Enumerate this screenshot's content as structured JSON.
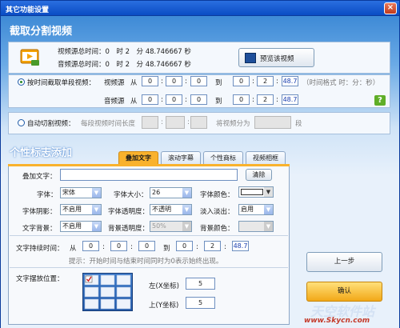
{
  "window": {
    "title": "其它功能设置",
    "close": "×"
  },
  "section1": {
    "title": "截取分割视频",
    "video_total_label": "视频源总时间：0　时 2　分 48.746667 秒",
    "audio_total_label": "音频源总时间：0　时 2　分 48.746667 秒",
    "preview_button": "预览该视频",
    "mode_time": {
      "label": "按时间截取单段视频：",
      "video_src": "视频源",
      "audio_src": "音频源",
      "from": "从",
      "to": "到",
      "hint": "（时间格式 时：分：秒）",
      "video_from": [
        "0",
        "0",
        "0"
      ],
      "video_to": [
        "0",
        "2",
        "48.7"
      ],
      "audio_from": [
        "0",
        "0",
        "0"
      ],
      "audio_to": [
        "0",
        "2",
        "48.7"
      ]
    },
    "mode_auto": {
      "label": "自动切割视频：",
      "segment_len_label": "每段视频时间长度",
      "split_into_label": "将视频分为",
      "segments_unit": "段"
    }
  },
  "section2": {
    "title": "个性标志添加",
    "tabs": [
      "叠加文字",
      "滚动字幕",
      "个性商标",
      "视频相框"
    ],
    "overlay_text_label": "叠加文字：",
    "overlay_text_value": "",
    "clear_button": "清除",
    "font_label": "字体：",
    "font_value": "宋体",
    "font_size_label": "字体大小：",
    "font_size_value": "26",
    "font_color_label": "字体颜色：",
    "shadow_label": "字体阴影：",
    "shadow_value": "不启用",
    "transparency_label": "字体透明度：",
    "transparency_value": "不透明",
    "fade_label": "淡入淡出：",
    "fade_value": "启用",
    "bg_label": "文字背景：",
    "bg_value": "不启用",
    "bg_trans_label": "背景透明度：",
    "bg_trans_value": "50%",
    "bg_color_label": "背景颜色：",
    "duration_label": "文字持续时间：",
    "from": "从",
    "to": "到",
    "dur_from": [
      "0",
      "0",
      "0"
    ],
    "dur_to": [
      "0",
      "2",
      "48.7"
    ],
    "tip": "提示：开始时间与结束时间同时为0表示始终出现。",
    "position_label": "文字摆放位置：",
    "left_label": "左(X坐标)",
    "left_value": "5",
    "top_label": "上(Y坐标)",
    "top_value": "5"
  },
  "actions": {
    "prev": "上一步",
    "ok": "确认"
  },
  "watermark": {
    "line1": "天空软件站",
    "line2": "www.Skycn.com"
  }
}
